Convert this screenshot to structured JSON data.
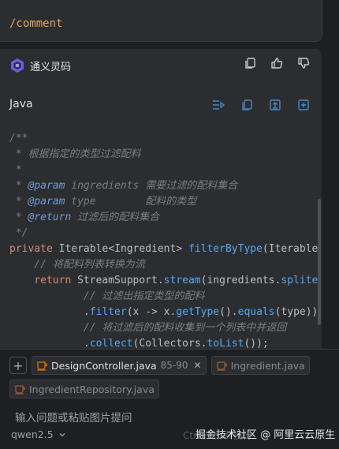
{
  "previous_message": {
    "command": "/comment"
  },
  "assistant": {
    "name": "通义灵码",
    "actions": [
      "copy-icon",
      "thumbs-up-icon",
      "thumbs-down-icon"
    ]
  },
  "code_block": {
    "language": "Java",
    "actions": [
      "insert-diff-icon",
      "copy-icon",
      "insert-file-icon",
      "new-file-icon"
    ],
    "lines": [
      [
        [
          "c-com",
          "/**"
        ]
      ],
      [
        [
          "c-com",
          " * 根据指定的类型过滤配料"
        ]
      ],
      [
        [
          "c-com",
          " *"
        ]
      ],
      [
        [
          "c-com",
          " * "
        ],
        [
          "c-tag",
          "@param"
        ],
        [
          "c-com",
          " ingredients 需要过滤的配料集合"
        ]
      ],
      [
        [
          "c-com",
          " * "
        ],
        [
          "c-tag",
          "@param"
        ],
        [
          "c-com",
          " type        配料的类型"
        ]
      ],
      [
        [
          "c-com",
          " * "
        ],
        [
          "c-tag",
          "@return"
        ],
        [
          "c-com",
          " 过滤后的配料集合"
        ]
      ],
      [
        [
          "c-com",
          " */"
        ]
      ],
      [
        [
          "c-kw",
          "private "
        ],
        [
          "c-cls",
          "Iterable<Ingredient> "
        ],
        [
          "c-fn",
          "filterByType"
        ],
        [
          "c-cls",
          "(Iterable"
        ]
      ],
      [
        [
          "c-com",
          "    // 将配料列表转换为流"
        ]
      ],
      [
        [
          "c-kw",
          "    return "
        ],
        [
          "c-cls",
          "StreamSupport."
        ],
        [
          "c-fn",
          "stream"
        ],
        [
          "c-cls",
          "(ingredients."
        ],
        [
          "c-fn",
          "splite"
        ]
      ],
      [
        [
          "c-com",
          "            // 过滤出指定类型的配料"
        ]
      ],
      [
        [
          "c-cls",
          "            ."
        ],
        [
          "c-fn",
          "filter"
        ],
        [
          "c-cls",
          "(x -> x."
        ],
        [
          "c-fn",
          "getType"
        ],
        [
          "c-cls",
          "()."
        ],
        [
          "c-fn",
          "equals"
        ],
        [
          "c-cls",
          "(type))"
        ]
      ],
      [
        [
          "c-com",
          "            // 将过滤后的配料收集到一个列表中并返回"
        ]
      ],
      [
        [
          "c-cls",
          "            ."
        ],
        [
          "c-fn",
          "collect"
        ],
        [
          "c-cls",
          "(Collectors."
        ],
        [
          "c-fn",
          "toList"
        ],
        [
          "c-cls",
          "());"
        ]
      ]
    ]
  },
  "context": {
    "files": [
      {
        "name": "DesignController.java",
        "range": "85-90",
        "active": true
      },
      {
        "name": "Ingredient.java",
        "active": false
      },
      {
        "name": "IngredientRepository.java",
        "active": false
      }
    ]
  },
  "input": {
    "placeholder": "输入问题或粘贴图片提问",
    "model": "qwen2.5",
    "hint": "Ctrl+Enter换行"
  },
  "watermark": "掘金技术社区 @ 阿里云云原生",
  "colors": {
    "accent": "#4a88c7",
    "java_icon": "#e76f00",
    "background": "#1e1f22",
    "card": "#2b2d30"
  }
}
